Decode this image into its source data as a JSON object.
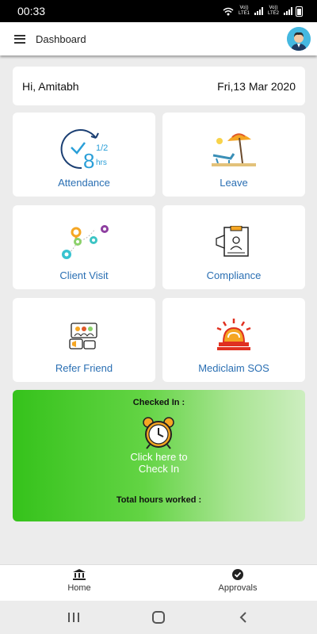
{
  "status_bar": {
    "time": "00:33",
    "sim1": "Vo)) LTE1",
    "sim2": "Vo)) LTE2"
  },
  "app_bar": {
    "title": "Dashboard"
  },
  "greeting": {
    "text": "Hi, Amitabh",
    "date": "Fri,13 Mar 2020"
  },
  "tiles": [
    {
      "label": "Attendance",
      "icon": "clock-half-hours-icon"
    },
    {
      "label": "Leave",
      "icon": "beach-umbrella-icon"
    },
    {
      "label": "Client Visit",
      "icon": "location-pins-icon"
    },
    {
      "label": "Compliance",
      "icon": "document-badge-icon"
    },
    {
      "label": "Refer Friend",
      "icon": "people-megaphone-icon"
    },
    {
      "label": "Mediclaim SOS",
      "icon": "alarm-siren-icon"
    }
  ],
  "attendance_icon_text": {
    "whole": "8",
    "fraction": "1/2",
    "unit": "hrs"
  },
  "checkin": {
    "title": "Checked In :",
    "cta_line1": "Click here to",
    "cta_line2": "Check In",
    "hours_label": "Total hours worked :"
  },
  "bottom_nav": {
    "home": "Home",
    "approvals": "Approvals"
  },
  "colors": {
    "accent_text": "#2a6fb3",
    "checkin_gradient_start": "#35c21b",
    "checkin_gradient_end": "#cdeec0"
  }
}
